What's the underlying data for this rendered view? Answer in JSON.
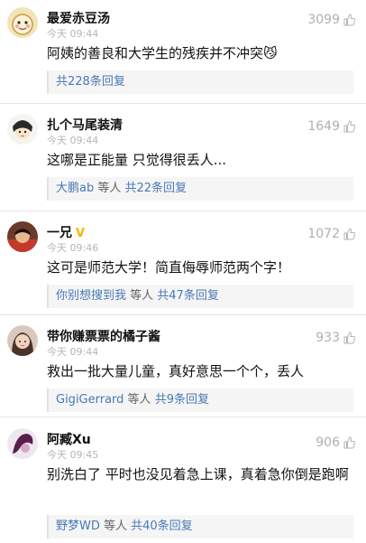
{
  "comments": [
    {
      "avatar": "cartoon-avatar",
      "name": "最爱赤豆汤",
      "vip": "",
      "time": "今天 09:44",
      "likes": "3099",
      "text": "阿姨的善良和大学生的残疾并不冲突😼",
      "reply_user": "",
      "reply_mid": "",
      "reply_count": "共228条回复"
    },
    {
      "avatar": "cartoon-avatar",
      "name": "扎个马尾装清",
      "vip": "",
      "time": "今天 09:44",
      "likes": "1649",
      "text": "这哪是正能量 只觉得很丢人...",
      "reply_user": "大鹏ab",
      "reply_mid": " 等人 ",
      "reply_count": "共22条回复"
    },
    {
      "avatar": "photo-avatar",
      "name": "一兄",
      "vip": "V",
      "time": "今天 09:46",
      "likes": "1072",
      "text": "这可是师范大学！简直侮辱师范两个字！",
      "reply_user": "你别想搜到我",
      "reply_mid": " 等人 ",
      "reply_count": "共47条回复"
    },
    {
      "avatar": "photo-avatar",
      "name": "带你赚票票的橘子酱",
      "vip": "",
      "time": "今天 09:44",
      "likes": "933",
      "text": "救出一批大量儿童，真好意思一个个，丢人",
      "reply_user": "GigiGerrard",
      "reply_mid": " 等人 ",
      "reply_count": "共9条回复"
    },
    {
      "avatar": "photo-avatar",
      "name": "阿臧Xu",
      "vip": "",
      "time": "今天 09:45",
      "likes": "906",
      "text": "别洗白了 平时也没见着急上课，真着急你倒是跑啊",
      "reply_user": "野梦WD",
      "reply_mid": " 等人 ",
      "reply_count": "共40条回复"
    }
  ],
  "colors": {
    "link": "#4a79b6",
    "meta": "#b5b5b5",
    "vip": "#f2b600"
  }
}
